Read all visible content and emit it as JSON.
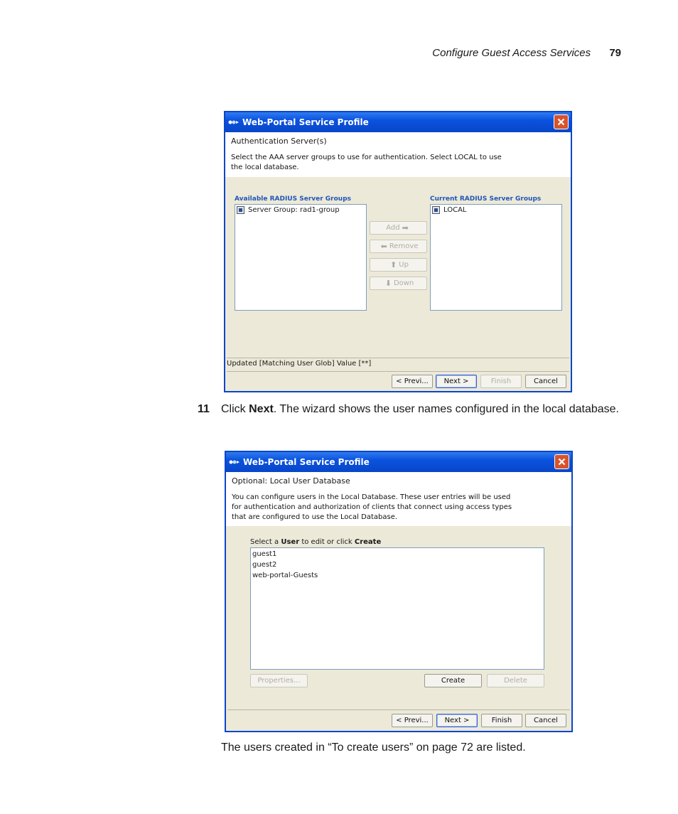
{
  "header": {
    "section": "Configure Guest Access Services",
    "page_number": "79"
  },
  "window1": {
    "title": "Web-Portal Service Profile",
    "heading": "Authentication Server(s)",
    "description_line1": "Select the AAA server groups to use for authentication. Select LOCAL to use",
    "description_line2": "the local database.",
    "available_label": "Available RADIUS Server Groups",
    "available_items": [
      "Server Group: rad1-group"
    ],
    "current_label": "Current RADIUS Server Groups",
    "current_items": [
      "LOCAL"
    ],
    "add_label": "Add",
    "remove_label": "Remove",
    "up_label": "Up",
    "down_label": "Down",
    "status_text": "Updated [Matching User Glob] Value [**]",
    "prev_label": "< Previ...",
    "next_label": "Next >",
    "finish_label": "Finish",
    "cancel_label": "Cancel"
  },
  "step": {
    "number": "11",
    "pre": "Click ",
    "bold": "Next",
    "post": ". The wizard shows the user names configured in the local database."
  },
  "window2": {
    "title": "Web-Portal Service Profile",
    "heading": "Optional: Local User Database",
    "description_line1": "You can configure users in the Local Database. These user entries will be used",
    "description_line2": "for authentication and authorization of clients that connect using access types",
    "description_line3": "that are configured to use the Local Database.",
    "select_pre": "Select a ",
    "select_user": "User",
    "select_mid": " to edit or click ",
    "select_create": "Create",
    "users": [
      "guest1",
      "guest2",
      "web-portal-Guests"
    ],
    "properties_label": "Properties...",
    "create_label": "Create",
    "delete_label": "Delete",
    "prev_label": "< Previ...",
    "next_label": "Next >",
    "finish_label": "Finish",
    "cancel_label": "Cancel"
  },
  "footer_text": "The users created in “To create users” on page 72 are listed.",
  "colors": {
    "titlebar": "#0a52de",
    "close_button": "#d8532b",
    "dialog_bg": "#ece9d8",
    "group_label": "#2056b8"
  }
}
